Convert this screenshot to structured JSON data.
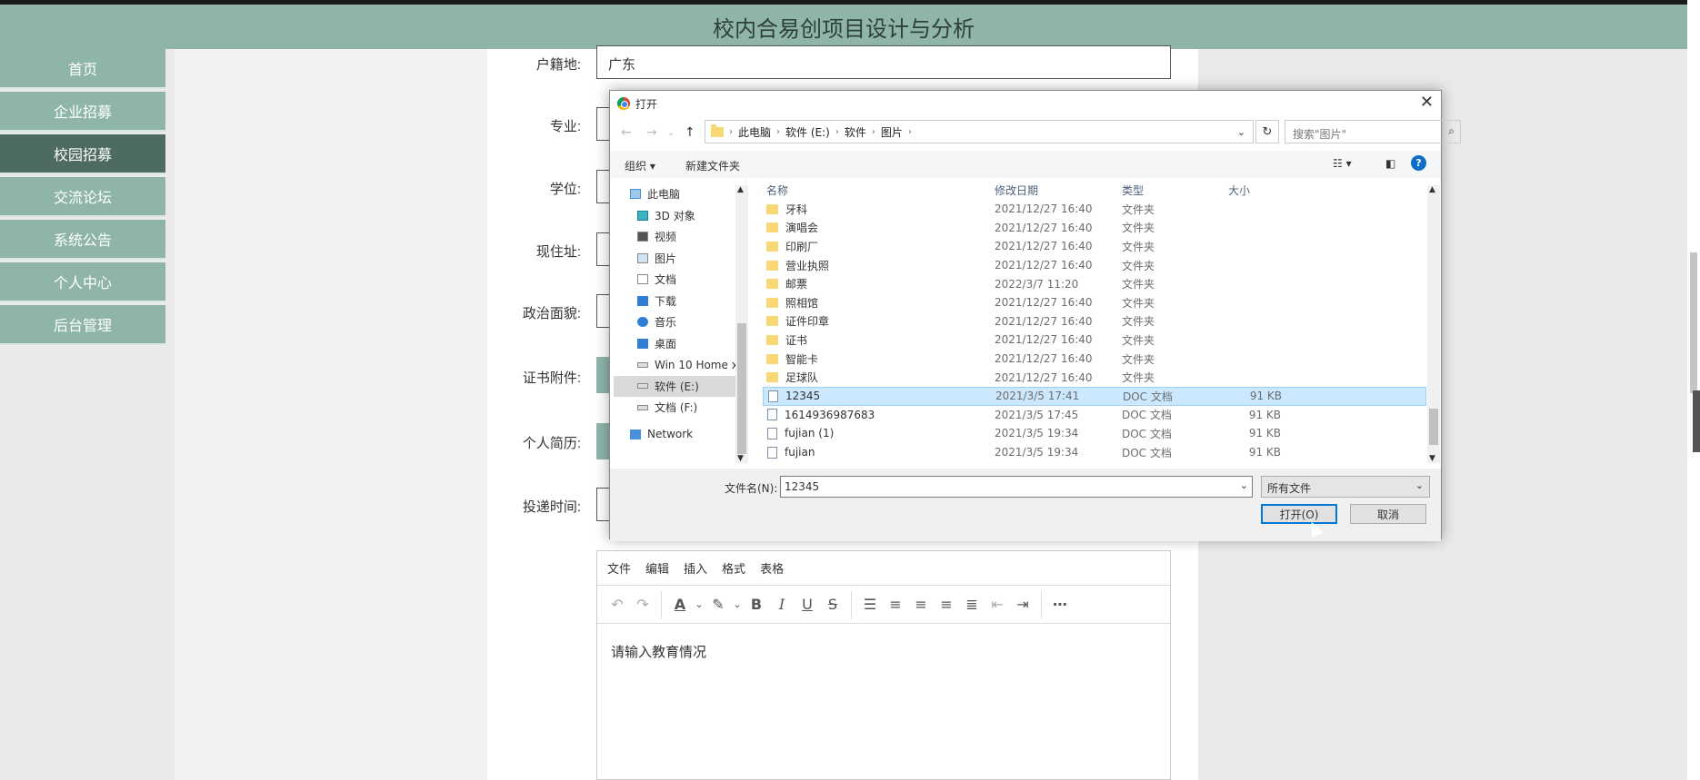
{
  "header": {
    "title": "校内合易创项目设计与分析"
  },
  "sidebar": {
    "items": [
      {
        "label": "首页",
        "active": false
      },
      {
        "label": "企业招募",
        "active": false
      },
      {
        "label": "校园招募",
        "active": true
      },
      {
        "label": "交流论坛",
        "active": false
      },
      {
        "label": "系统公告",
        "active": false
      },
      {
        "label": "个人中心",
        "active": false
      },
      {
        "label": "后台管理",
        "active": false
      }
    ]
  },
  "form": {
    "labels": {
      "huji": "户籍地:",
      "zhuanye": "专业:",
      "xuewei": "学位:",
      "xianzhuzhi": "现住址:",
      "zhengzhi": "政治面貌:",
      "zhengshu": "证书附件:",
      "jianli": "个人简历:",
      "toudi": "投递时间:"
    },
    "huji_value": "广东"
  },
  "editor": {
    "menu": [
      "文件",
      "编辑",
      "插入",
      "格式",
      "表格"
    ],
    "placeholder": "请输入教育情况"
  },
  "dialog": {
    "title": "打开",
    "close": "✕",
    "breadcrumb": [
      "此电脑",
      "软件 (E:)",
      "软件",
      "图片"
    ],
    "search_placeholder": "搜索\"图片\"",
    "organize": "组织 ▾",
    "new_folder": "新建文件夹",
    "nav_tree": [
      {
        "label": "此电脑",
        "icon": "computer-icon",
        "selected": false
      },
      {
        "label": "3D 对象",
        "icon": "3d-objects-icon",
        "selected": false
      },
      {
        "label": "视频",
        "icon": "video-icon",
        "selected": false
      },
      {
        "label": "图片",
        "icon": "pictures-icon",
        "selected": false
      },
      {
        "label": "文档",
        "icon": "documents-icon",
        "selected": false
      },
      {
        "label": "下载",
        "icon": "download-icon",
        "selected": false
      },
      {
        "label": "音乐",
        "icon": "music-icon",
        "selected": false
      },
      {
        "label": "桌面",
        "icon": "desktop-icon",
        "selected": false
      },
      {
        "label": "Win 10 Home x",
        "icon": "drive-icon",
        "selected": false
      },
      {
        "label": "软件 (E:)",
        "icon": "drive-icon",
        "selected": true
      },
      {
        "label": "文档 (F:)",
        "icon": "drive-icon",
        "selected": false
      },
      {
        "label": "Network",
        "icon": "network-icon",
        "selected": false
      }
    ],
    "columns": [
      "名称",
      "修改日期",
      "类型",
      "大小"
    ],
    "files": [
      {
        "name": "牙科",
        "date": "2021/12/27 16:40",
        "type": "文件夹",
        "size": "",
        "kind": "folder",
        "selected": false
      },
      {
        "name": "演唱会",
        "date": "2021/12/27 16:40",
        "type": "文件夹",
        "size": "",
        "kind": "folder",
        "selected": false
      },
      {
        "name": "印刷厂",
        "date": "2021/12/27 16:40",
        "type": "文件夹",
        "size": "",
        "kind": "folder",
        "selected": false
      },
      {
        "name": "营业执照",
        "date": "2021/12/27 16:40",
        "type": "文件夹",
        "size": "",
        "kind": "folder",
        "selected": false
      },
      {
        "name": "邮票",
        "date": "2022/3/7 11:20",
        "type": "文件夹",
        "size": "",
        "kind": "folder",
        "selected": false
      },
      {
        "name": "照相馆",
        "date": "2021/12/27 16:40",
        "type": "文件夹",
        "size": "",
        "kind": "folder",
        "selected": false
      },
      {
        "name": "证件印章",
        "date": "2021/12/27 16:40",
        "type": "文件夹",
        "size": "",
        "kind": "folder",
        "selected": false
      },
      {
        "name": "证书",
        "date": "2021/12/27 16:40",
        "type": "文件夹",
        "size": "",
        "kind": "folder",
        "selected": false
      },
      {
        "name": "智能卡",
        "date": "2021/12/27 16:40",
        "type": "文件夹",
        "size": "",
        "kind": "folder",
        "selected": false
      },
      {
        "name": "足球队",
        "date": "2021/12/27 16:40",
        "type": "文件夹",
        "size": "",
        "kind": "folder",
        "selected": false
      },
      {
        "name": "12345",
        "date": "2021/3/5 17:41",
        "type": "DOC 文档",
        "size": "91 KB",
        "kind": "doc",
        "selected": true
      },
      {
        "name": "1614936987683",
        "date": "2021/3/5 17:45",
        "type": "DOC 文档",
        "size": "91 KB",
        "kind": "doc",
        "selected": false
      },
      {
        "name": "fujian (1)",
        "date": "2021/3/5 19:34",
        "type": "DOC 文档",
        "size": "91 KB",
        "kind": "doc",
        "selected": false
      },
      {
        "name": "fujian",
        "date": "2021/3/5 19:34",
        "type": "DOC 文档",
        "size": "91 KB",
        "kind": "doc",
        "selected": false
      }
    ],
    "filename_label": "文件名(N):",
    "filename_value": "12345",
    "filter_value": "所有文件",
    "open_button": "打开(O)",
    "cancel_button": "取消"
  },
  "colors": {
    "accent": "#8fb5ab",
    "active": "#4d6b62",
    "selection": "#cce8ff",
    "help": "#0b6fc7"
  }
}
